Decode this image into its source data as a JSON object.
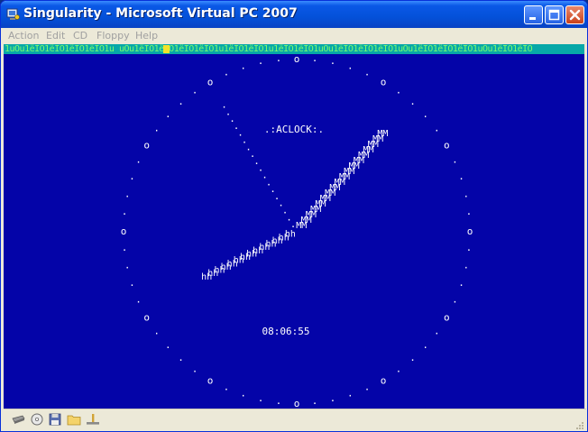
{
  "window": {
    "title": "Singularity - Microsoft Virtual PC 2007",
    "app_icon": "virtual-pc-icon",
    "buttons": [
      "minimize-icon",
      "maximize-icon",
      "close-icon"
    ]
  },
  "menu": {
    "items": [
      {
        "label": "Action"
      },
      {
        "label": "Edit"
      },
      {
        "label": "CD"
      },
      {
        "label": "Floppy"
      },
      {
        "label": "Help"
      }
    ]
  },
  "screen": {
    "status_line": "1uOu1ëÏÒ1ëÏÒ1ëÏÒ1ëÏÒ1u  uOu1ëÏÒ1ëÏÒ1ëÏÒ1ëÏÒ1u1ëÏÒ1ëÏÒ1u1ëÏÒ1ëÏÒ1uOu1ëÏÒ1ëÏÒ1ëÏÒ1uOu1ëÏÒ1ëÏÒ1ëÏÒ1uOu1ëÏÒ1ëÏÒ",
    "clock_label": ".:ACLOCK:.",
    "time": "08:06:55",
    "hour_marker_glyph": "o",
    "minute_marker_glyph": ".",
    "hour_hand_glyph": "hh",
    "minute_hand_glyph": "MM",
    "second_hand_glyph": ".",
    "colors": {
      "background": "#0404a8",
      "text": "#ffffff",
      "status_bar": "#07a8a8"
    }
  },
  "statusbar": {
    "icons": [
      "hard-disk-icon",
      "cd-drive-icon",
      "floppy-icon",
      "shared-folder-icon",
      "network-icon"
    ]
  }
}
